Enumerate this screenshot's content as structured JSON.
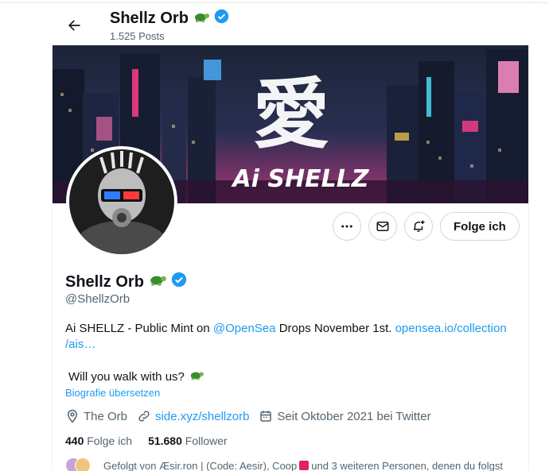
{
  "header": {
    "name": "Shellz Orb",
    "posts": "1.525 Posts"
  },
  "banner": {
    "kanji": "愛",
    "title": "Ai SHELLZ"
  },
  "actions": {
    "more_icon": "more-dots-icon",
    "message_icon": "envelope-icon",
    "notify_icon": "bell-plus-icon",
    "follow_label": "Folge ich"
  },
  "profile": {
    "name": "Shellz Orb",
    "handle": "@ShellzOrb",
    "bio": {
      "part1": "Ai SHELLZ - Public Mint on ",
      "mention": "@OpenSea",
      "part2": " Drops November 1st. ",
      "link1": "opensea.io/collection",
      "link2": "/ais…",
      "line2": "Will you walk with us?"
    },
    "translate": "Biografie übersetzen",
    "location": "The Orb",
    "website": "side.xyz/shellzorb",
    "joined": "Seit Oktober 2021 bei Twitter"
  },
  "counts": {
    "following_value": "440",
    "following_label": "Folge ich",
    "followers_value": "51.680",
    "followers_label": "Follower"
  },
  "followed_by": {
    "prefix": "Gefolgt von Æsir.ron | (Code: Aesir), Coop",
    "suffix": " und 3 weiteren Personen, denen du folgst"
  },
  "colors": {
    "verified": "#1d9bf0",
    "link": "#1d9bf0",
    "secondary_text": "#536471"
  }
}
